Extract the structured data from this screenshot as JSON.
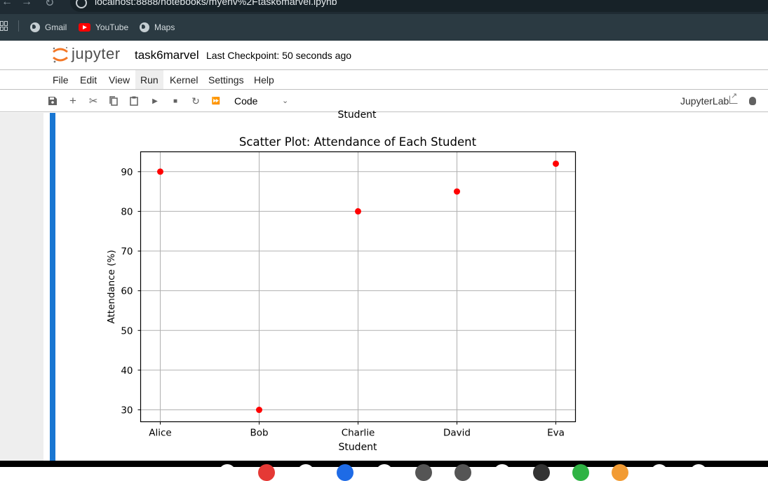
{
  "browser": {
    "url": "localhost:8888/notebooks/myenv%2Ftask6marvel.ipynb",
    "bookmarks": [
      {
        "label": "Gmail",
        "icon": "globe-icon"
      },
      {
        "label": "YouTube",
        "icon": "youtube-icon"
      },
      {
        "label": "Maps",
        "icon": "globe-icon"
      }
    ]
  },
  "jupyter": {
    "logo_text": "jupyter",
    "notebook_title": "task6marvel",
    "checkpoint": "Last Checkpoint: 50 seconds ago",
    "menu": [
      "File",
      "Edit",
      "View",
      "Run",
      "Kernel",
      "Settings",
      "Help"
    ],
    "active_menu": "Run",
    "cell_type": "Code",
    "jupyterlab_link": "JupyterLab"
  },
  "output": {
    "prev_xlabel_fragment": "Student"
  },
  "chart_data": {
    "type": "scatter",
    "title": "Scatter Plot: Attendance of Each Student",
    "xlabel": "Student",
    "ylabel": "Attendance (%)",
    "categories": [
      "Alice",
      "Bob",
      "Charlie",
      "David",
      "Eva"
    ],
    "values": [
      90,
      30,
      80,
      85,
      92
    ],
    "yticks": [
      30,
      40,
      50,
      60,
      70,
      80,
      90
    ],
    "ylim": [
      27,
      95
    ],
    "grid": true,
    "marker_color": "#ff0000"
  }
}
